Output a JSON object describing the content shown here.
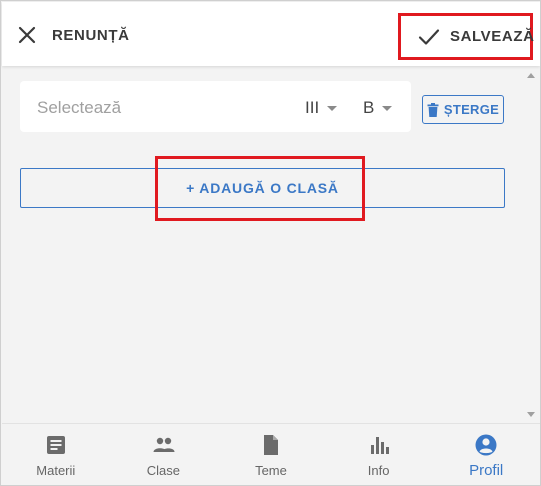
{
  "header": {
    "cancel_label": "RENUNȚĂ",
    "cancel_icon": "close-icon",
    "save_label": "SALVEAZĂ",
    "save_icon": "check-icon"
  },
  "form": {
    "select_placeholder": "Selectează",
    "grade_value": "III",
    "letter_value": "B",
    "delete_label": "ȘTERGE",
    "delete_icon": "trash-icon",
    "add_class_label": "+ ADAUGĂ O CLASĂ"
  },
  "bottom_nav": {
    "items": [
      {
        "label": "Materii",
        "icon": "book-icon",
        "active": false
      },
      {
        "label": "Clase",
        "icon": "people-icon",
        "active": false
      },
      {
        "label": "Teme",
        "icon": "document-icon",
        "active": false
      },
      {
        "label": "Info",
        "icon": "bar-chart-icon",
        "active": false
      },
      {
        "label": "Profil",
        "icon": "account-circle-icon",
        "active": true
      }
    ]
  },
  "colors": {
    "accent": "#3b78c6",
    "highlight": "#e0191f",
    "icon_gray": "#6b6b6b"
  }
}
